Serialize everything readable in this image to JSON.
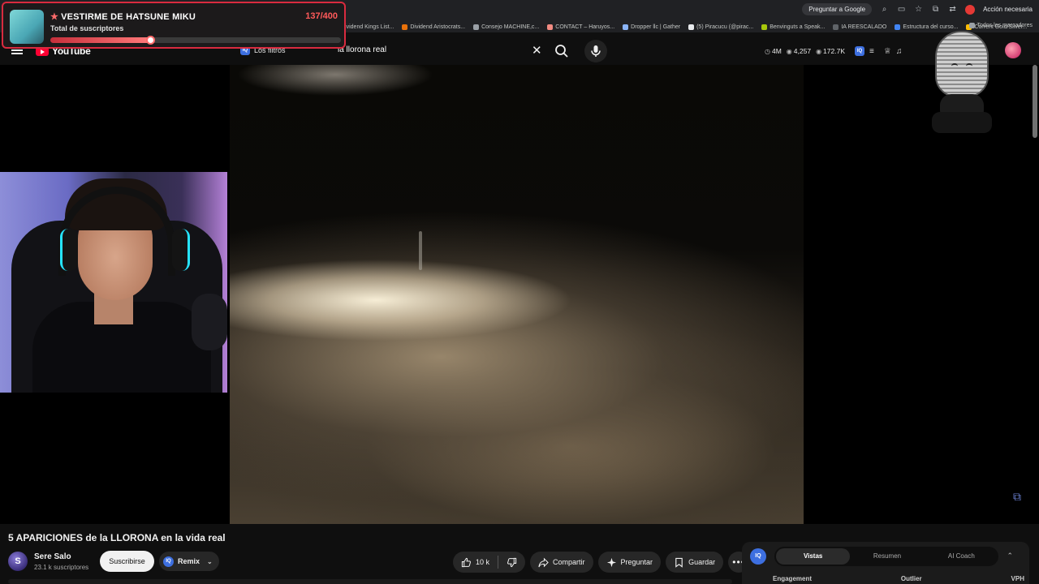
{
  "browser": {
    "ask_google": "Preguntar a Google",
    "action_needed": "Acción necesaria",
    "all_bookmarks": "Todos los marcadores",
    "bookmarks": [
      "Dividend Kings List...",
      "Dividend Aristocrats...",
      "Consejo MACHINE,c...",
      "CONTACT – Haruyos...",
      "Dropper llc | Gather",
      "(5) Piracucu (@pirac...",
      "Benvinguts a Speak...",
      "IA REESCALADO",
      "Estructura del curso...",
      "Current Gold/Silver..."
    ]
  },
  "sub_alert": {
    "title": "VESTIRME DE HATSUNE MIKU",
    "subtitle": "Total de suscriptores",
    "count": "137/400",
    "progress": 0.3425
  },
  "header": {
    "logo": "YouTube",
    "filters_label": "Los filtros",
    "search_value": "la llorona real",
    "stats": {
      "subs": "4M",
      "views": "4,257",
      "total": "172.7K"
    },
    "iq_label": "IQ"
  },
  "video": {
    "title": "5 APARICIONES de la LLORONA en la vida real",
    "channel": {
      "name": "Sere Salo",
      "initial": "S",
      "subscribers": "23.1 k suscriptores"
    },
    "subscribe_label": "Suscribirse",
    "remix_label": "Remix",
    "likes": "10 k",
    "share_label": "Compartir",
    "ask_label": "Preguntar",
    "save_label": "Guardar"
  },
  "panel": {
    "tabs": [
      "Vistas",
      "Resumen",
      "AI Coach"
    ],
    "columns": [
      "Engagement",
      "Outlier",
      "VPH"
    ]
  },
  "colors": {
    "accent_red": "#ff0033",
    "alert_border": "#d92b3f",
    "iq_blue": "#3d6fe0"
  }
}
